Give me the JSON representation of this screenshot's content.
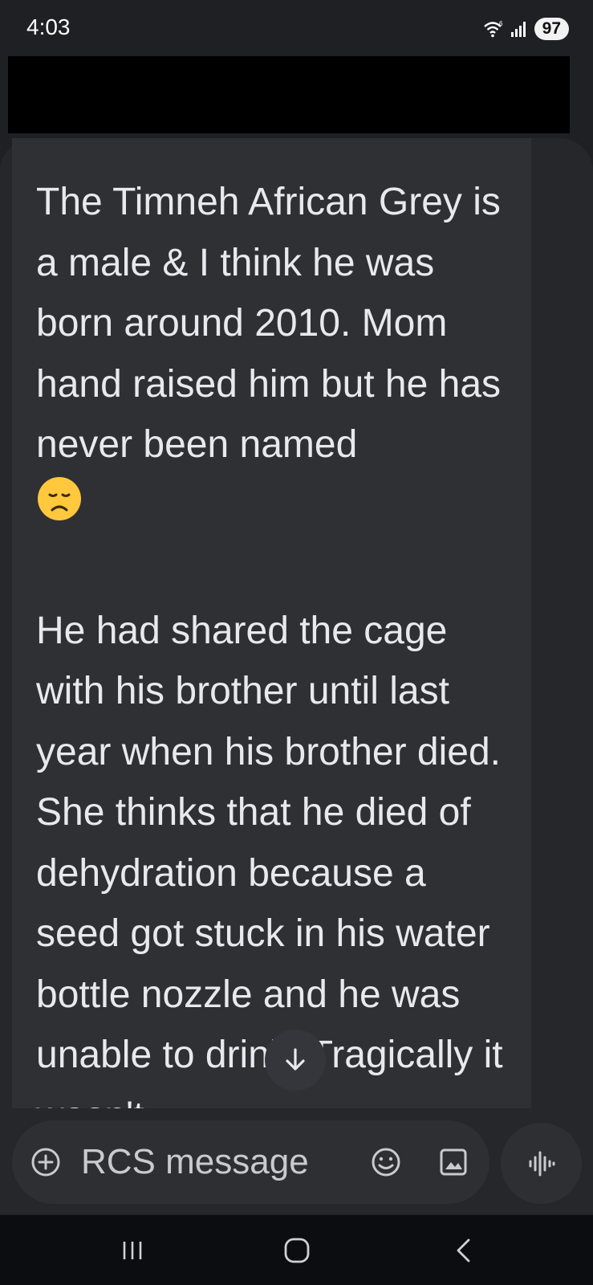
{
  "status_bar": {
    "time": "4:03",
    "battery": "97",
    "icons": [
      "wifi-icon",
      "signal-icon"
    ]
  },
  "message": {
    "paragraph1": "The Timneh African Grey is a male & I think he was born around 2010. Mom hand raised him but he has never been named",
    "emoji": "disappointed-face",
    "paragraph2": "He had shared the cage with his brother until last year when his brother died. She thinks that he died of dehydration because a seed got stuck in his water bottle nozzle and he was unable to drink. Tragically it wasn't"
  },
  "compose": {
    "placeholder": "RCS message",
    "icons": [
      "add-icon",
      "emoji-icon",
      "gallery-icon",
      "voice-icon"
    ]
  },
  "nav": {
    "icons": [
      "recents-icon",
      "home-icon",
      "back-icon"
    ]
  },
  "colors": {
    "background": "#1f2024",
    "bubble": "#2f3034",
    "text": "#e8e9ee",
    "emoji_yellow": "#ffc83d"
  }
}
